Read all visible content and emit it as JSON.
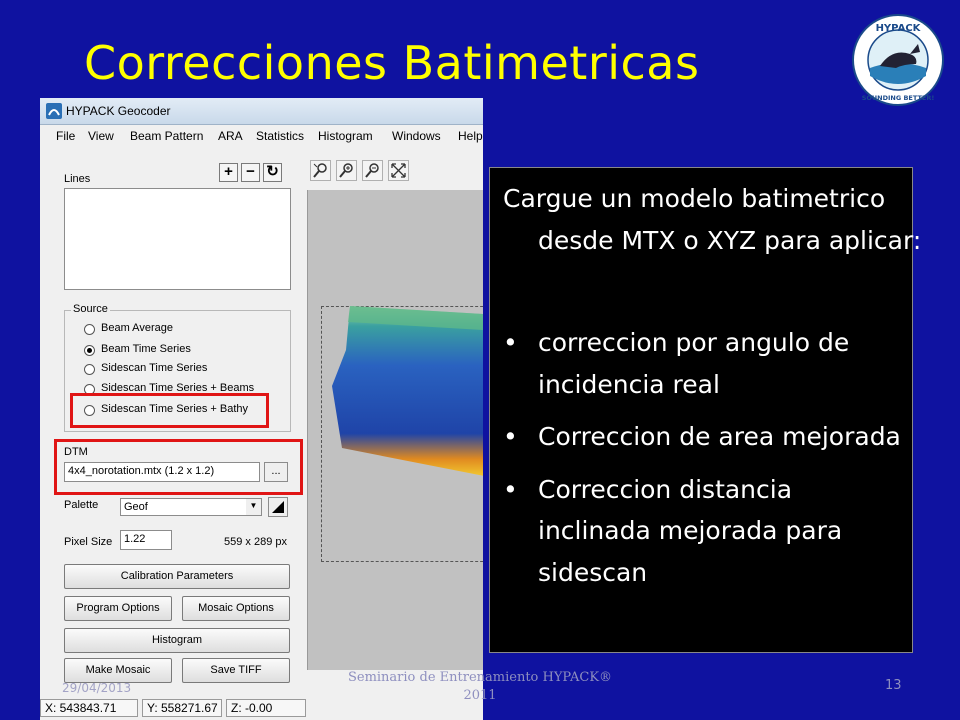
{
  "slide": {
    "title": "Correcciones Batimetricas",
    "logo": {
      "icon": "hypack-whale-logo",
      "top_text": "HYPACK",
      "bottom_text": "SOUNDING BETTER!"
    },
    "footer": {
      "date": "29/04/2013",
      "center": "Seminario de Entrenamiento HYPACK® 2011",
      "page_number": "13"
    }
  },
  "app": {
    "title": "HYPACK Geocoder",
    "menu": [
      "File",
      "View",
      "Beam Pattern",
      "ARA",
      "Statistics",
      "Histogram",
      "Windows",
      "Help"
    ],
    "lines_label": "Lines",
    "source": {
      "label": "Source",
      "options": [
        {
          "label": "Beam Average",
          "selected": false
        },
        {
          "label": "Beam Time Series",
          "selected": true
        },
        {
          "label": "Sidescan Time Series",
          "selected": false
        },
        {
          "label": "Sidescan Time Series + Beams",
          "selected": false
        },
        {
          "label": "Sidescan Time Series + Bathy",
          "selected": false
        }
      ]
    },
    "dtm": {
      "label": "DTM",
      "value": "4x4_norotation.mtx (1.2 x 1.2)",
      "browse": "..."
    },
    "palette": {
      "label": "Palette",
      "value": "Geof"
    },
    "pixel_size": {
      "label": "Pixel Size",
      "value": "1.22",
      "dimensions": "559 x 289 px"
    },
    "buttons": {
      "calibration": "Calibration Parameters",
      "program_options": "Program Options",
      "mosaic_options": "Mosaic Options",
      "histogram": "Histogram",
      "make_mosaic": "Make Mosaic",
      "save_tiff": "Save TIFF"
    },
    "status": {
      "x": "X: 543843.71",
      "y": "Y: 558271.67",
      "z": "Z: -0.00"
    },
    "highlight_color": "#e01515"
  },
  "textbox": {
    "intro": "Cargue un modelo batimetrico desde MTX o XYZ para aplicar:",
    "bullets": [
      "correccion por angulo de incidencia real",
      "Correccion de area mejorada",
      "Correccion distancia inclinada mejorada para sidescan"
    ]
  },
  "colors": {
    "background": "#0f12a0",
    "title": "#ffff00",
    "box": "#000000"
  }
}
